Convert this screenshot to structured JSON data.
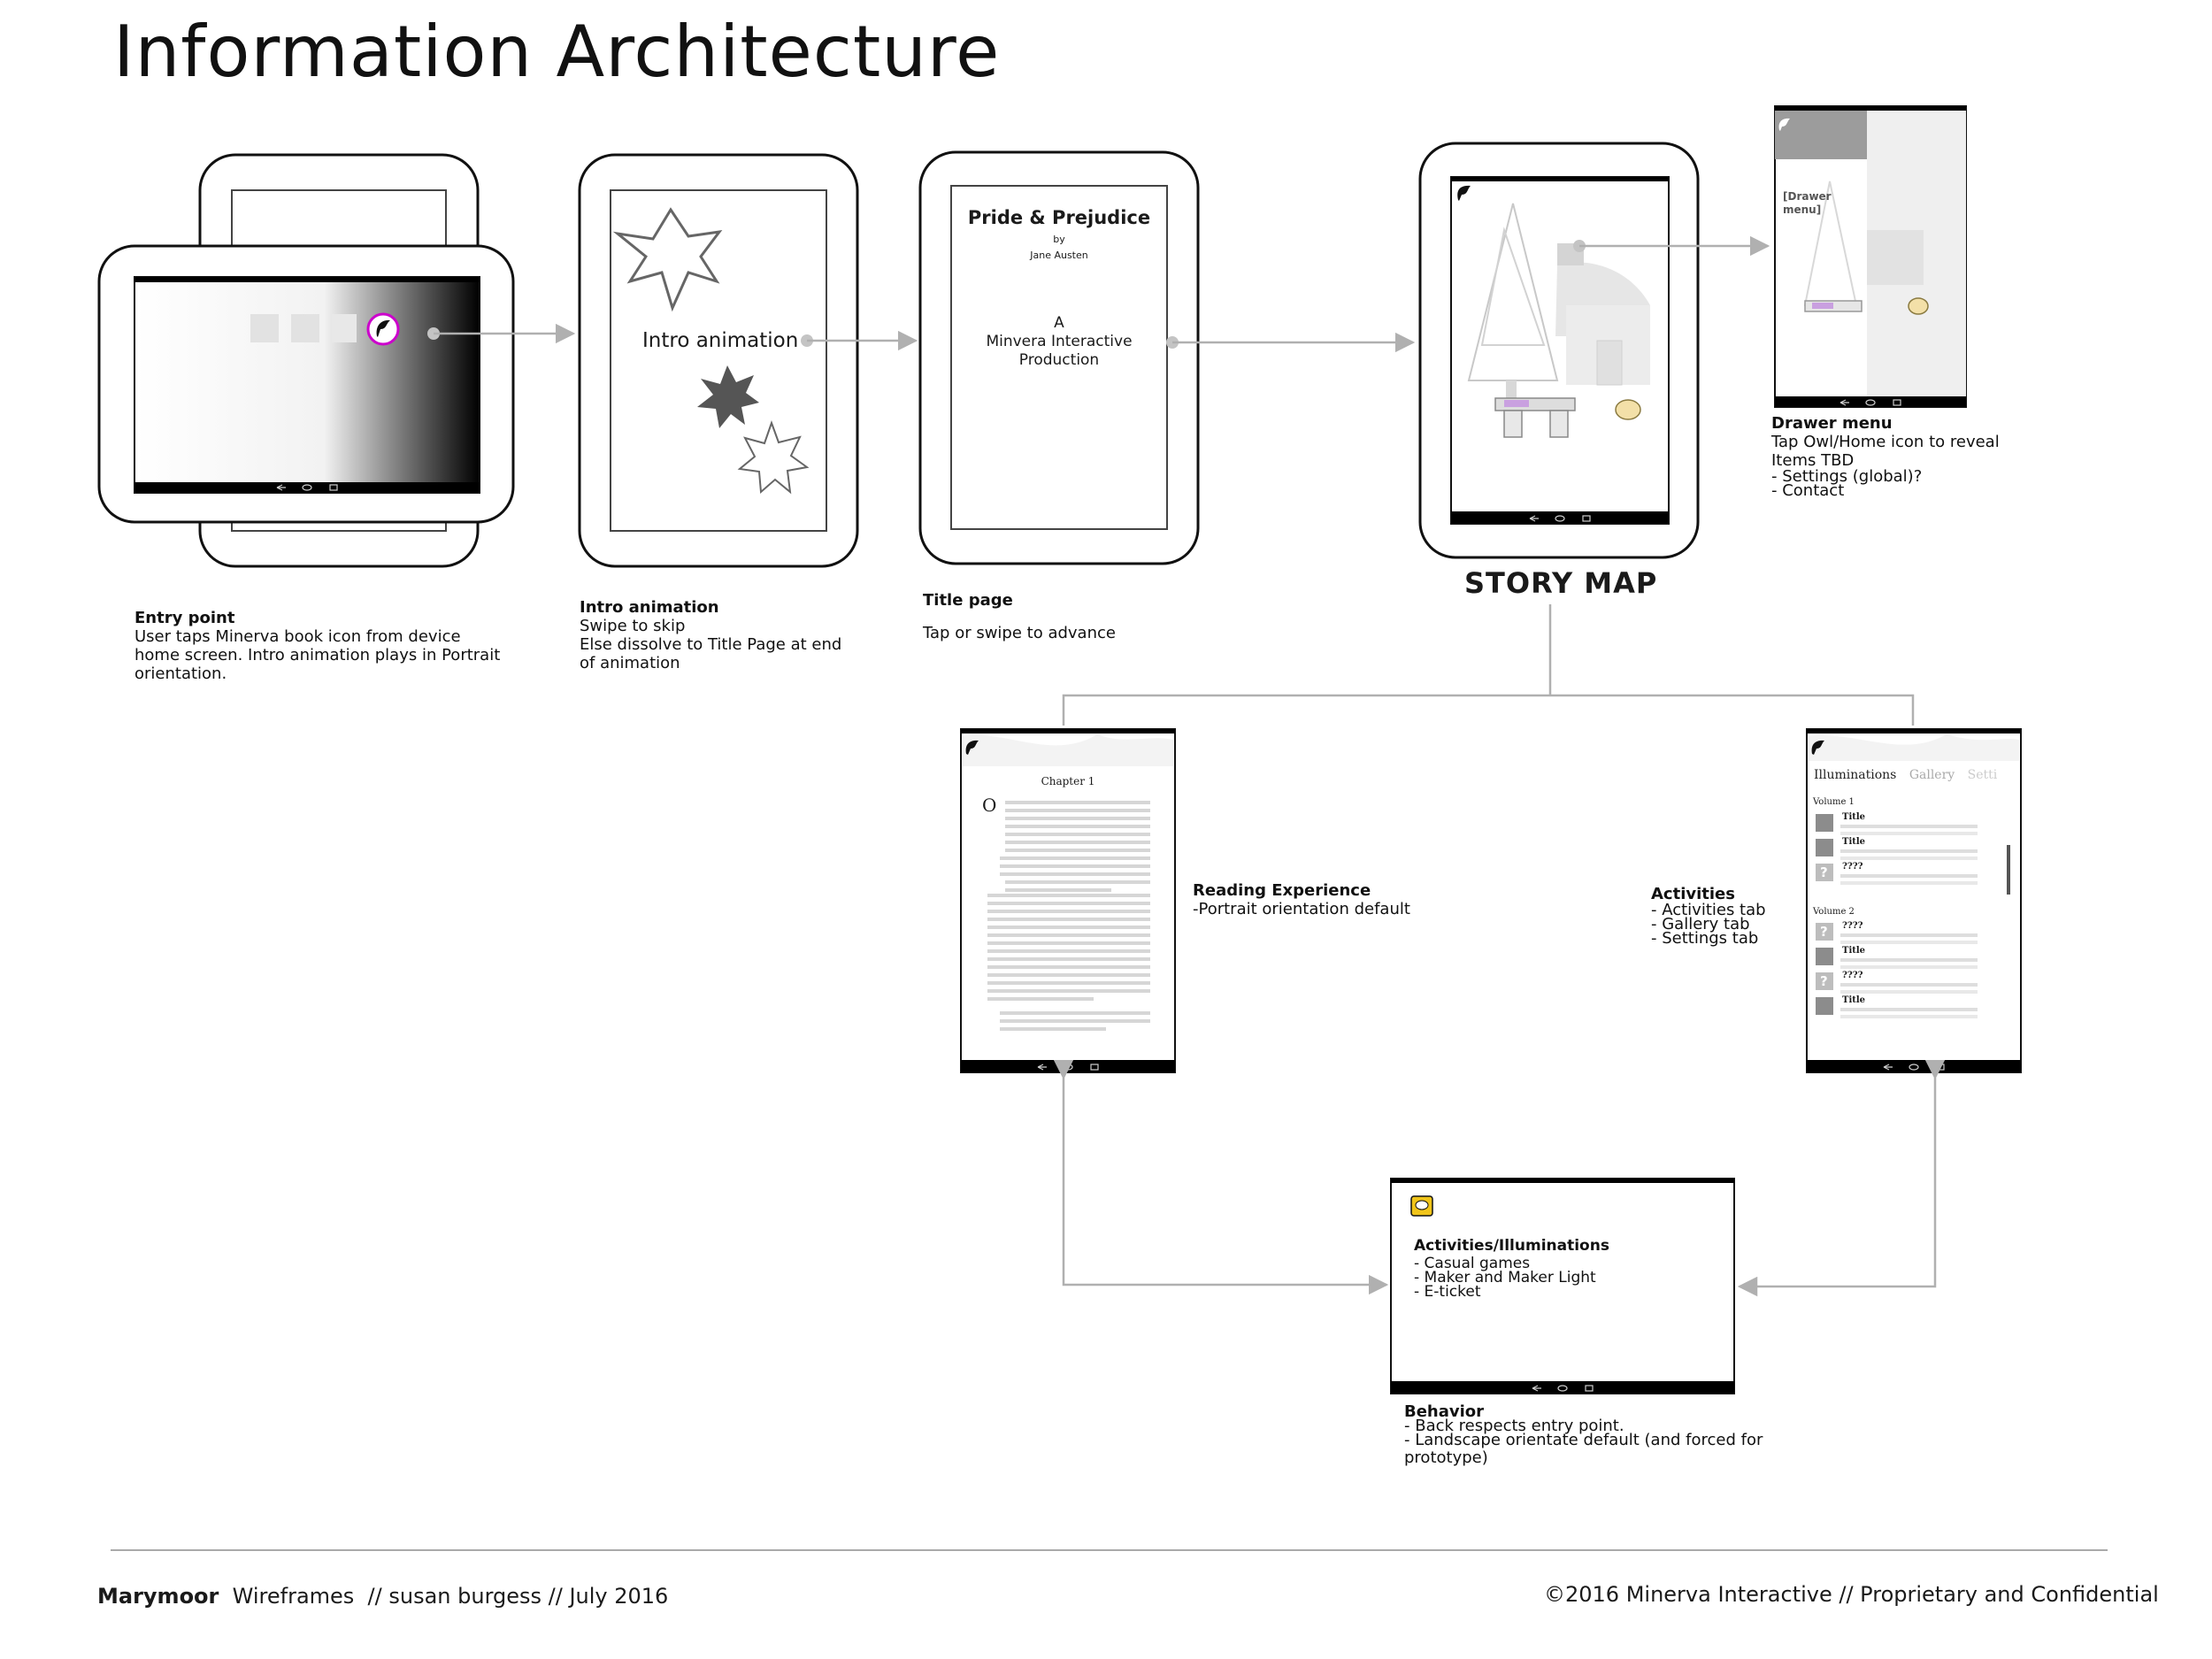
{
  "page_title": "Information Architecture",
  "entry_point": {
    "heading": "Entry point",
    "lines": [
      "User taps Minerva book icon from device",
      "home screen. Intro animation plays in Portrait",
      "orientation."
    ]
  },
  "intro_animation": {
    "screen_label": "Intro animation",
    "heading": "Intro animation",
    "lines": [
      "Swipe to skip",
      "Else dissolve to Title Page at end",
      "of animation"
    ]
  },
  "title_page": {
    "book_title": "Pride & Prejudice",
    "by": "by",
    "author": "Jane Austen",
    "production_lines": [
      "A",
      "Minvera Interactive",
      "Production"
    ],
    "heading": "Title page",
    "lines": [
      "Tap or swipe to advance"
    ]
  },
  "story_map": {
    "label": "STORY MAP"
  },
  "drawer_menu": {
    "screen_label_lines": [
      "[Drawer",
      "menu]"
    ],
    "heading": "Drawer menu",
    "lines": [
      "Tap Owl/Home icon to reveal",
      "Items TBD",
      "- Settings (global)?",
      "- Contact"
    ]
  },
  "reading_experience": {
    "chapter": "Chapter 1",
    "drop_cap": "O",
    "heading": "Reading Experience",
    "lines": [
      "-Portrait orientation default"
    ]
  },
  "activities": {
    "tabs": [
      "Illuminations",
      "Gallery",
      "Setti"
    ],
    "volume1": "Volume 1",
    "volume2": "Volume 2",
    "items_v1": [
      "Title",
      "Title",
      "????"
    ],
    "items_v2": [
      "????",
      "Title",
      "????",
      "Title"
    ],
    "unknown_glyph": "?",
    "heading": "Activities",
    "lines": [
      "- Activities tab",
      "- Gallery tab",
      "- Settings tab"
    ]
  },
  "activities_illuminations": {
    "heading": "Activities/Illuminations",
    "lines": [
      "- Casual games",
      "- Maker and Maker Light",
      "- E-ticket"
    ]
  },
  "behavior": {
    "heading": "Behavior",
    "lines": [
      "- Back respects entry point.",
      "- Landscape orientate default (and forced for",
      "prototype)"
    ]
  },
  "footer": {
    "brand": "Marymoor",
    "rest": "  Wireframes  // susan burgess // July 2016",
    "copyright": "©2016 Minerva Interactive // Proprietary and Confidential"
  },
  "colors": {
    "line": "#9a9a9a",
    "highlight": "#cc00cc",
    "accent_yellow": "#f0c419"
  }
}
